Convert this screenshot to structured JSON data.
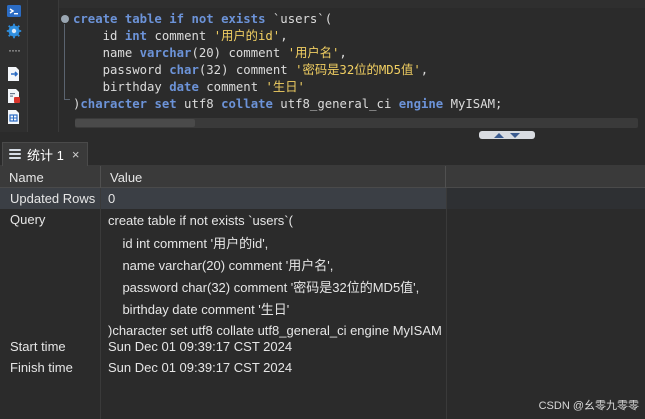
{
  "editor": {
    "lines": [
      [
        {
          "t": "create table if not exists ",
          "c": "kw"
        },
        {
          "t": "`users`",
          "c": "plain"
        },
        {
          "t": "(",
          "c": "plain"
        }
      ],
      [
        {
          "t": "    id ",
          "c": "plain"
        },
        {
          "t": "int",
          "c": "kw"
        },
        {
          "t": " comment ",
          "c": "plain"
        },
        {
          "t": "'用户的id'",
          "c": "str"
        },
        {
          "t": ",",
          "c": "plain"
        }
      ],
      [
        {
          "t": "    name ",
          "c": "plain"
        },
        {
          "t": "varchar",
          "c": "kw"
        },
        {
          "t": "(20) comment ",
          "c": "plain"
        },
        {
          "t": "'用户名'",
          "c": "str"
        },
        {
          "t": ",",
          "c": "plain"
        }
      ],
      [
        {
          "t": "    password ",
          "c": "plain"
        },
        {
          "t": "char",
          "c": "kw"
        },
        {
          "t": "(32) comment ",
          "c": "plain"
        },
        {
          "t": "'密码是32位的MD5值'",
          "c": "str"
        },
        {
          "t": ",",
          "c": "plain"
        }
      ],
      [
        {
          "t": "    birthday ",
          "c": "plain"
        },
        {
          "t": "date",
          "c": "kw"
        },
        {
          "t": " comment ",
          "c": "plain"
        },
        {
          "t": "'生日'",
          "c": "str"
        }
      ],
      [
        {
          "t": ")",
          "c": "plain"
        },
        {
          "t": "character set",
          "c": "kw"
        },
        {
          "t": " utf8 ",
          "c": "plain"
        },
        {
          "t": "collate",
          "c": "kw"
        },
        {
          "t": " utf8_general_ci ",
          "c": "plain"
        },
        {
          "t": "engine",
          "c": "kw"
        },
        {
          "t": " MyISAM;",
          "c": "plain"
        }
      ]
    ]
  },
  "toolbar": {
    "icons": [
      "terminal-icon",
      "gear-icon",
      "more-icon",
      "export-icon",
      "script-icon",
      "table-doc-icon"
    ],
    "more_glyph": "····"
  },
  "results": {
    "tab_label": "统计 1",
    "tab_close": "×",
    "header": {
      "name": "Name",
      "value": "Value"
    },
    "updated_rows": {
      "label": "Updated Rows",
      "value": "0"
    },
    "query": {
      "label": "Query",
      "lines": [
        "create table if not exists `users`(",
        "    id int comment '用户的id',",
        "    name varchar(20) comment '用户名',",
        "    password char(32) comment '密码是32位的MD5值',",
        "    birthday date comment '生日'",
        ")character set utf8 collate utf8_general_ci engine MyISAM"
      ]
    },
    "start_time": {
      "label": "Start time",
      "value": "Sun Dec 01 09:39:17 CST 2024"
    },
    "finish_time": {
      "label": "Finish time",
      "value": "Sun Dec 01 09:39:17 CST 2024"
    }
  },
  "watermark": "CSDN @幺零九零零"
}
